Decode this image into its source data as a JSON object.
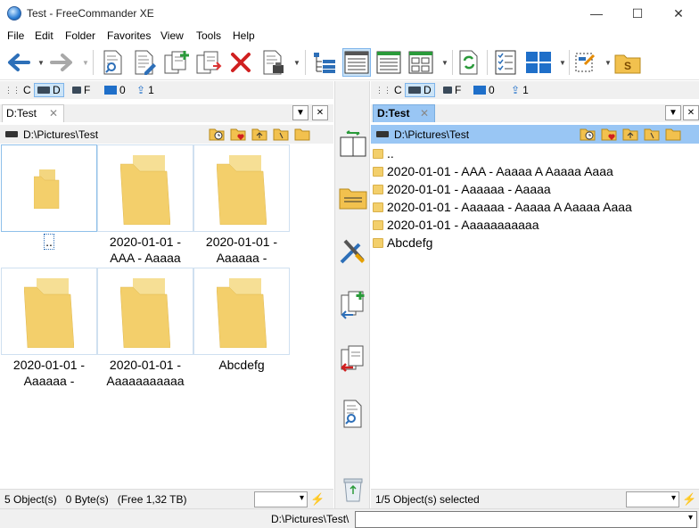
{
  "window": {
    "title": "Test - FreeCommander XE"
  },
  "window_buttons": {
    "minimize": "—",
    "maximize": "☐",
    "close": "✕"
  },
  "menu": [
    "File",
    "Edit",
    "Folder",
    "Favorites",
    "View",
    "Tools",
    "Help"
  ],
  "toolbar": {
    "icons": [
      "back-arrow-icon",
      "forward-arrow-icon",
      "view-file-icon",
      "edit-file-icon",
      "copy-file-icon",
      "move-file-icon",
      "delete-icon",
      "file-properties-icon",
      "tree-view-icon",
      "details-view-icon",
      "list-view-icon",
      "thumbnail-view-icon",
      "sync-icon",
      "checklist-icon",
      "tiles-view-icon",
      "settings-icon",
      "s-drive-icon"
    ]
  },
  "drives": [
    {
      "letter": "C"
    },
    {
      "letter": "D"
    },
    {
      "letter": "F"
    },
    {
      "letter": "0"
    },
    {
      "letter": "1"
    }
  ],
  "left": {
    "tab": "D:Test",
    "tab_close": "✕",
    "path": "D:\\Pictures\\Test",
    "items": [
      {
        "line1": "..",
        "line2": ""
      },
      {
        "line1": "2020-01-01 -",
        "line2": "AAA - Aaaaa"
      },
      {
        "line1": "2020-01-01 -",
        "line2": "Aaaaaa -"
      },
      {
        "line1": "2020-01-01 -",
        "line2": "Aaaaaa -"
      },
      {
        "line1": "2020-01-01 -",
        "line2": "Aaaaaaaaaaa"
      },
      {
        "line1": "Abcdefg",
        "line2": ""
      }
    ],
    "status": "5 Object(s)   0 Byte(s)   (Free 1,32 TB)"
  },
  "right": {
    "tab": "D:Test",
    "tab_close": "✕",
    "path": "D:\\Pictures\\Test",
    "items": [
      "..",
      "2020-01-01 - AAA - Aaaaa A Aaaaa Aaaa",
      "2020-01-01 - Aaaaaa - Aaaaa",
      "2020-01-01 - Aaaaaa - Aaaaa A Aaaaa Aaaa",
      "2020-01-01 - Aaaaaaaaaaa",
      "Abcdefg"
    ],
    "status": "1/5 Object(s) selected"
  },
  "tab_buttons": {
    "menu": "▼",
    "close": "✕"
  },
  "command_line": {
    "path": "D:\\Pictures\\Test\\"
  },
  "colors": {
    "active_path_bg": "#99c6f4",
    "folder": "#f3cf6b",
    "accent": "#2d7fd6"
  }
}
